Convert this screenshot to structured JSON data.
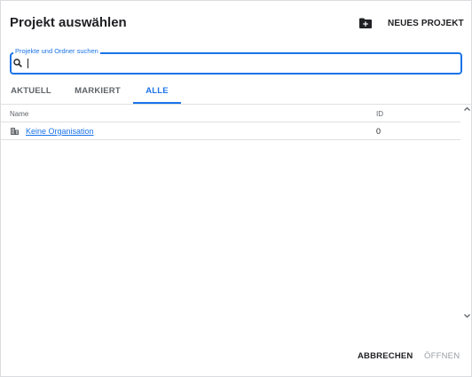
{
  "dialog": {
    "title": "Projekt auswählen",
    "new_project_label": "NEUES PROJEKT",
    "new_project_icon": "new-folder-icon"
  },
  "search": {
    "label": "Projekte und Ordner suchen",
    "value": "",
    "icon": "search-icon"
  },
  "tabs": [
    {
      "label": "AKTUELL",
      "active": false
    },
    {
      "label": "MARKIERT",
      "active": false
    },
    {
      "label": "ALLE",
      "active": true
    }
  ],
  "table": {
    "columns": {
      "name": "Name",
      "id": "ID"
    },
    "rows": [
      {
        "icon": "organization-icon",
        "name": "Keine Organisation",
        "id": "0"
      }
    ]
  },
  "footer": {
    "cancel_label": "ABBRECHEN",
    "open_label": "ÖFFNEN"
  },
  "colors": {
    "accent": "#1a73e8",
    "text": "#202124",
    "muted": "#5f6368",
    "disabled": "#9aa0a6",
    "divider": "#e0e0e0"
  }
}
